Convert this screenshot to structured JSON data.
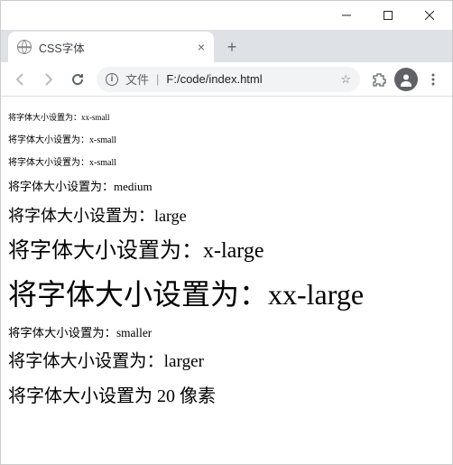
{
  "window": {
    "minimize": "−",
    "maximize": "□",
    "close": "×"
  },
  "tab": {
    "title": "CSS字体",
    "close": "×"
  },
  "newtab": "+",
  "omnibox": {
    "info": "i",
    "label": "文件",
    "sep": "|",
    "url": "F:/code/index.html",
    "star": "☆"
  },
  "lines": {
    "l1": "将字体大小设置为：xx-small",
    "l2": "将字体大小设置为：x-small",
    "l3": "将字体大小设置为：x-small",
    "l4": "将字体大小设置为：medium",
    "l5": "将字体大小设置为：large",
    "l6": "将字体大小设置为：x-large",
    "l7": "将字体大小设置为：xx-large",
    "l8": "将字体大小设置为：smaller",
    "l9": "将字体大小设置为：larger",
    "l10": "将字体大小设置为 20 像素"
  }
}
